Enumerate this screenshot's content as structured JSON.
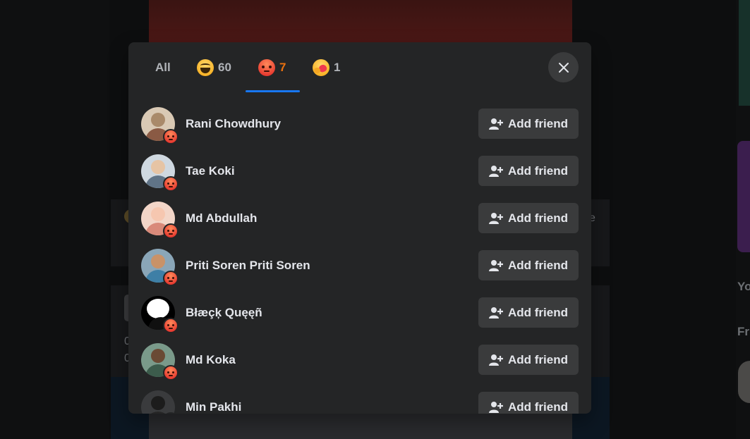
{
  "background": {
    "rail_text_1": "Yo",
    "rail_text_2": "Fri",
    "side_digit_1": "0",
    "side_digit_2": "0",
    "side_letter": "e"
  },
  "modal": {
    "tabs": [
      {
        "label": "All",
        "count": "",
        "emoji": "none"
      },
      {
        "label": "",
        "count": "60",
        "emoji": "haha"
      },
      {
        "label": "",
        "count": "7",
        "emoji": "angry",
        "active": true
      },
      {
        "label": "",
        "count": "1",
        "emoji": "care"
      }
    ],
    "active_color": "#e9710f",
    "underline_color": "#1877f2",
    "close_icon": "close-icon"
  },
  "people": [
    {
      "name": "Rani Chowdhury",
      "button": "Add friend"
    },
    {
      "name": "Tae Koki",
      "button": "Add friend"
    },
    {
      "name": "Md Abdullah",
      "button": "Add friend"
    },
    {
      "name": "Priti Soren Priti Soren",
      "button": "Add friend"
    },
    {
      "name": "Błæçķ Quęęñ",
      "button": "Add friend"
    },
    {
      "name": "Md Koka",
      "button": "Add friend"
    },
    {
      "name": "Min Pakhi",
      "button": "Add friend"
    }
  ]
}
